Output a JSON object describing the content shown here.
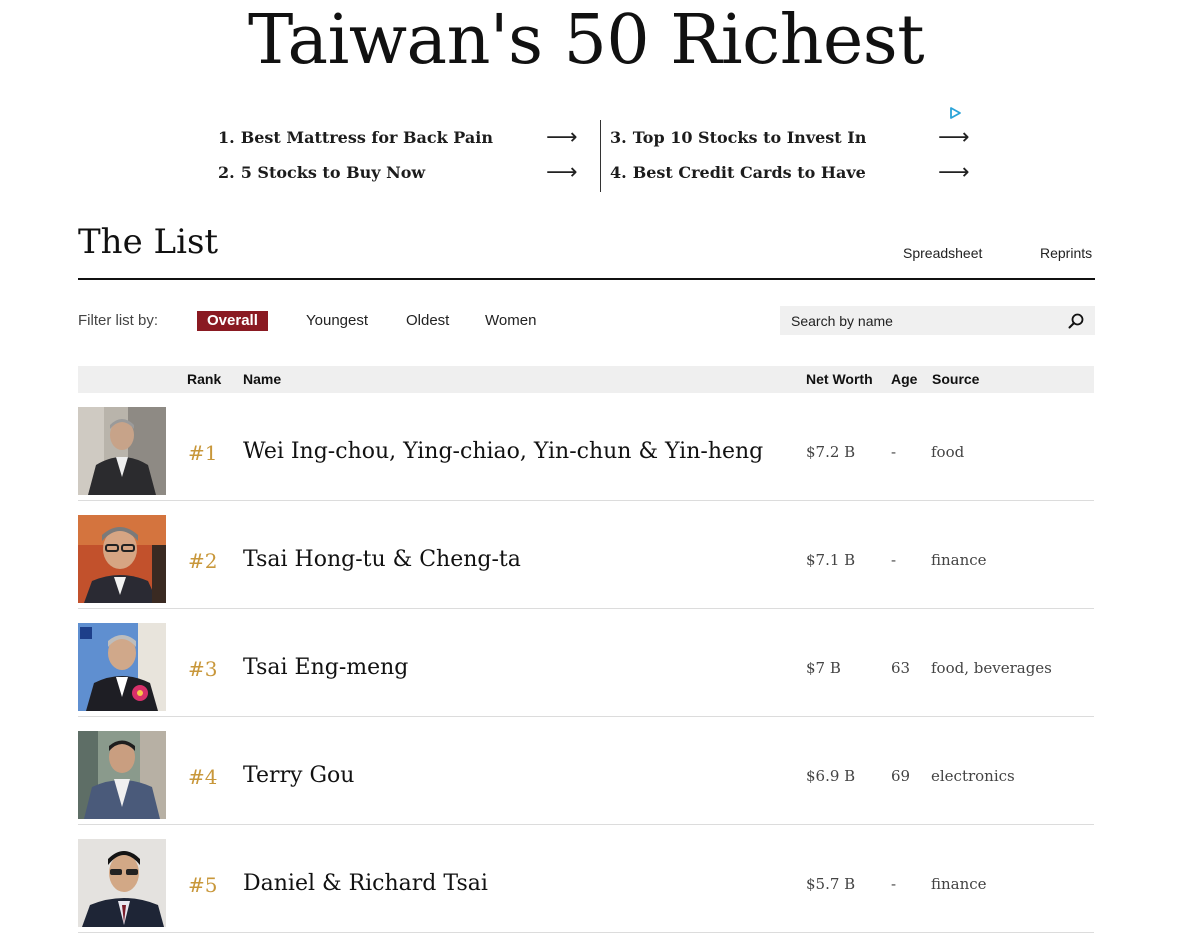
{
  "page": {
    "title": "Taiwan's 50 Richest"
  },
  "ad": {
    "items": [
      {
        "num": "1.",
        "label": "Best Mattress for Back Pain"
      },
      {
        "num": "2.",
        "label": "5 Stocks to Buy Now"
      },
      {
        "num": "3.",
        "label": "Top 10 Stocks to Invest In"
      },
      {
        "num": "4.",
        "label": "Best Credit Cards to Have"
      }
    ],
    "arrow": "⟶"
  },
  "list": {
    "title": "The List",
    "links": {
      "spreadsheet": "Spreadsheet",
      "reprints": "Reprints"
    }
  },
  "filter": {
    "label": "Filter list by:",
    "options": [
      "Overall",
      "Youngest",
      "Oldest",
      "Women"
    ],
    "active": "Overall"
  },
  "search": {
    "placeholder": "Search by name",
    "value": ""
  },
  "table": {
    "headers": {
      "rank": "Rank",
      "name": "Name",
      "net_worth": "Net Worth",
      "age": "Age",
      "source": "Source"
    },
    "rows": [
      {
        "rank": "#1",
        "name": "Wei Ing-chou, Ying-chiao, Yin-chun & Yin-heng",
        "net_worth": "$7.2 B",
        "age": "-",
        "source": "food"
      },
      {
        "rank": "#2",
        "name": "Tsai Hong-tu & Cheng-ta",
        "net_worth": "$7.1 B",
        "age": "-",
        "source": "finance"
      },
      {
        "rank": "#3",
        "name": "Tsai Eng-meng",
        "net_worth": "$7 B",
        "age": "63",
        "source": "food, beverages"
      },
      {
        "rank": "#4",
        "name": "Terry Gou",
        "net_worth": "$6.9 B",
        "age": "69",
        "source": "electronics"
      },
      {
        "rank": "#5",
        "name": "Daniel & Richard Tsai",
        "net_worth": "$5.7 B",
        "age": "-",
        "source": "finance"
      }
    ]
  },
  "colors": {
    "accent": "#8a1a22",
    "rank": "#c8973a",
    "header_bg": "#efefef"
  }
}
